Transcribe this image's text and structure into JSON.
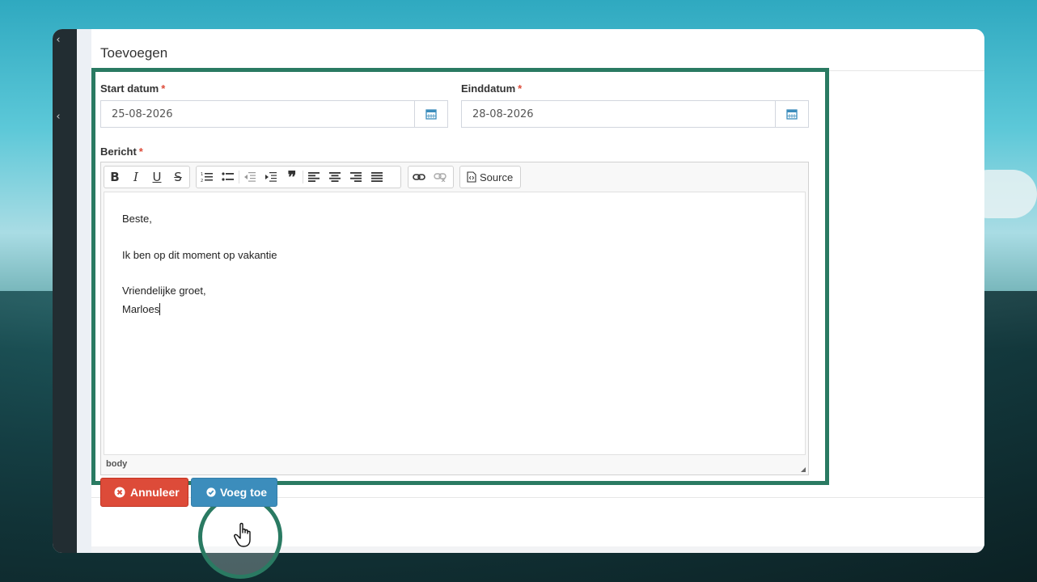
{
  "panel": {
    "title": "Toevoegen"
  },
  "form": {
    "start": {
      "label": "Start datum",
      "required_mark": "*",
      "value": "25-08-2026"
    },
    "end": {
      "label": "Einddatum",
      "required_mark": "*",
      "value": "28-08-2026"
    },
    "message": {
      "label": "Bericht",
      "required_mark": "*"
    }
  },
  "editor": {
    "toolbar": {
      "bold": "B",
      "italic": "I",
      "underline": "U",
      "strike": "S",
      "source_label": "Source"
    },
    "content": {
      "line1": "Beste,",
      "line2": "Ik ben op dit moment op vakantie",
      "line3": "Vriendelijke groet,",
      "line4": "Marloes"
    },
    "path": "body"
  },
  "actions": {
    "cancel_label": "Annuleer",
    "add_label": "Voeg toe"
  },
  "colors": {
    "highlight": "#2a7a62",
    "cancel": "#dd4b39",
    "primary": "#3c8dbc",
    "sidebar": "#222d32"
  }
}
